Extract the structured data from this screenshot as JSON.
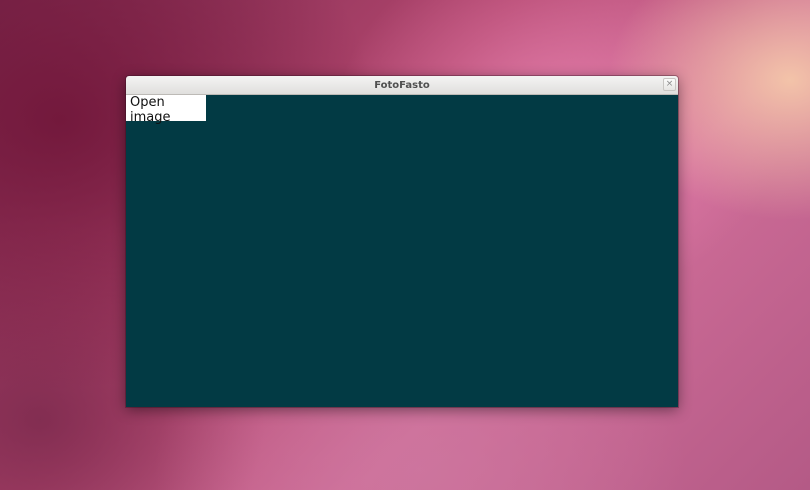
{
  "window": {
    "title": "FotoFasto",
    "close_icon": "close-icon",
    "close_glyph": "×",
    "content_background": "#023a44"
  },
  "toolbar": {
    "open_image_label": "Open image"
  }
}
